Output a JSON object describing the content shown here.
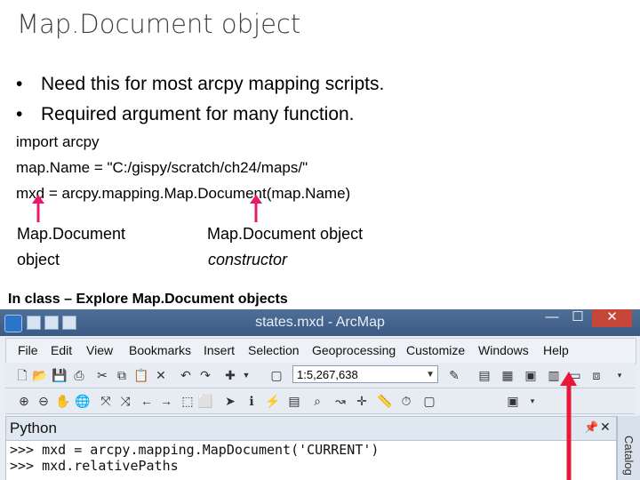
{
  "slide": {
    "title": "Map.Document object",
    "bullets": [
      "Need this for most arcpy mapping scripts.",
      "Required argument for many function."
    ],
    "code": [
      "import arcpy",
      "map.Name = \"C:/gispy/scratch/ch24/maps/\"",
      "mxd = arcpy.mapping.Map.Document(map.Name)"
    ],
    "label_left_line1": "Map.Document",
    "label_left_line2": "object",
    "label_right_line1": "Map.Document object",
    "label_right_line2": "constructor",
    "class_note": "In class – Explore Map.Document objects",
    "arrow_color": "#e8186e"
  },
  "window": {
    "title": "states.mxd - ArcMap",
    "menu": [
      "File",
      "Edit",
      "View",
      "Bookmarks",
      "Insert",
      "Selection",
      "Geoprocessing",
      "Customize",
      "Windows",
      "Help"
    ],
    "scale": "1:5,267,638",
    "python_title": "Python",
    "python_lines": [
      ">>> mxd = arcpy.mapping.MapDocument('CURRENT')",
      ">>> mxd.relativePaths"
    ],
    "catalog_label": "Catalog",
    "close_glyph": "✕"
  }
}
